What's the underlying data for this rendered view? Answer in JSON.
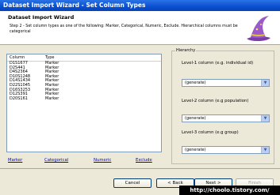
{
  "window": {
    "title": "Dataset Import Wizard - Set Column Types"
  },
  "header": {
    "title": "Dataset Import Wizard",
    "description": "Step 2 - Set column types as one of the following: Marker, Categorical, Numeric, Exclude. Hierarchical columns must be categorical"
  },
  "table": {
    "headers": [
      "Column",
      "Type"
    ],
    "rows": [
      [
        "D1S1677",
        "Marker"
      ],
      [
        "D2S441",
        "Marker"
      ],
      [
        "D4S2364",
        "Marker"
      ],
      [
        "D10S1248",
        "Marker"
      ],
      [
        "D14S1434",
        "Marker"
      ],
      [
        "D22S1045",
        "Marker"
      ],
      [
        "D16S3253",
        "Marker"
      ],
      [
        "D12S391",
        "Marker"
      ],
      [
        "D20S161",
        "Marker"
      ]
    ]
  },
  "type_links": [
    "Marker",
    "Categorical",
    "Numeric",
    "Exclude"
  ],
  "hierarchy": {
    "legend": "Hierarchy",
    "level1": {
      "label": "Level-1 column (e.g. individual id)",
      "value": "(generate)"
    },
    "level2": {
      "label": "Level-2 column (e.g population)",
      "value": "(generate)"
    },
    "level3": {
      "label": "Level-3 column (e.g group)",
      "value": "(generate)"
    }
  },
  "buttons": {
    "cancel": "Cancel",
    "back": "< Back",
    "next": "Next >",
    "finish": "Finish"
  },
  "watermark": "http://choolo.tistory.com/"
}
